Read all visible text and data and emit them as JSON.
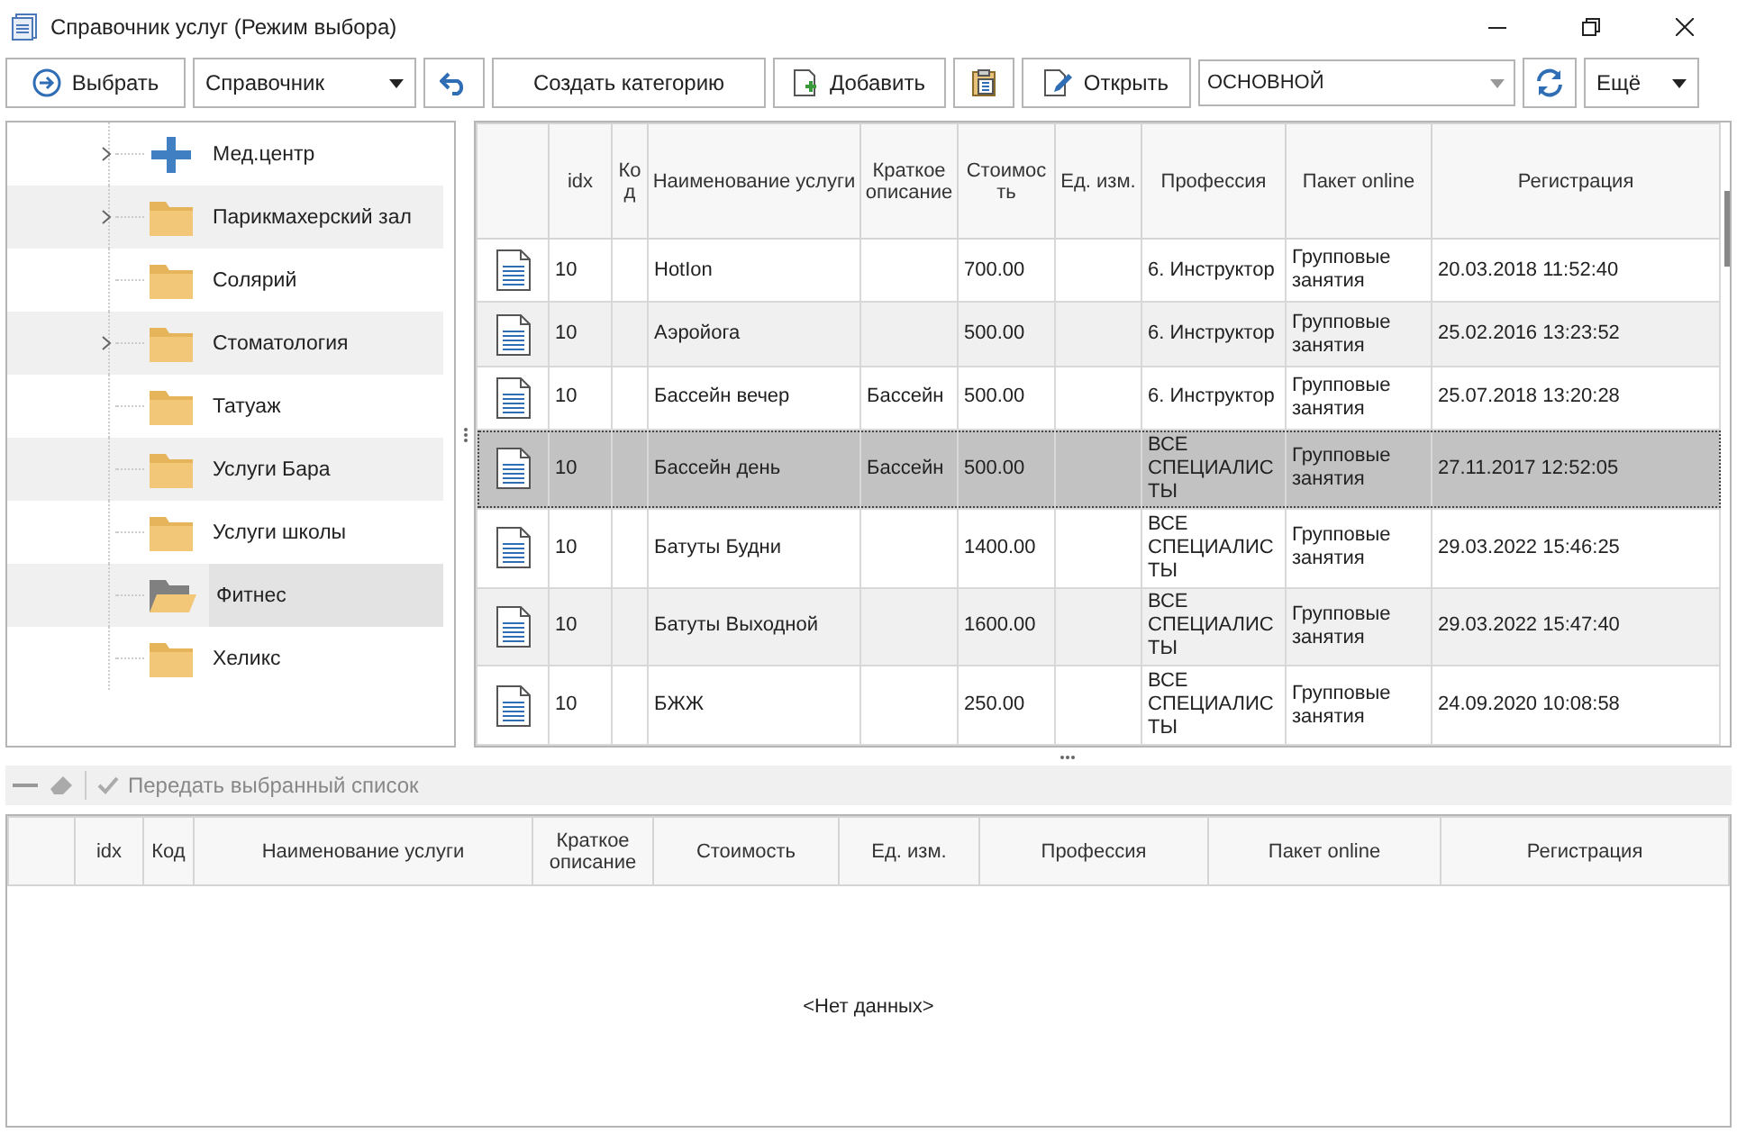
{
  "window": {
    "title": "Справочник услуг (Режим выбора)"
  },
  "toolbar": {
    "select_button": "Выбрать",
    "catalog_dropdown": "Справочник",
    "create_category_button": "Создать категорию",
    "add_button": "Добавить",
    "open_button": "Открыть",
    "profile_combo": "ОСНОВНОЙ",
    "more_dropdown": "Ещё"
  },
  "tree": {
    "items": [
      {
        "label": "Мед.центр",
        "kind": "plus",
        "expandable": true,
        "selected": false
      },
      {
        "label": "Парикмахерский зал",
        "kind": "folder",
        "expandable": true,
        "selected": false
      },
      {
        "label": "Солярий",
        "kind": "folder",
        "expandable": false,
        "selected": false
      },
      {
        "label": "Стоматология",
        "kind": "folder",
        "expandable": true,
        "selected": false
      },
      {
        "label": "Татуаж",
        "kind": "folder",
        "expandable": false,
        "selected": false
      },
      {
        "label": "Услуги Бара",
        "kind": "folder",
        "expandable": false,
        "selected": false
      },
      {
        "label": "Услуги школы",
        "kind": "folder",
        "expandable": false,
        "selected": false
      },
      {
        "label": "Фитнес",
        "kind": "opened",
        "expandable": false,
        "selected": true
      },
      {
        "label": "Хеликс",
        "kind": "folder",
        "expandable": false,
        "selected": false
      }
    ]
  },
  "grid": {
    "columns": [
      "idx",
      "Код",
      "Наименование услуги",
      "Краткое описание",
      "Стоимость",
      "Ед. изм.",
      "Профессия",
      "Пакет online",
      "Регистрация"
    ],
    "rows": [
      {
        "idx": "10",
        "name": "HotIon",
        "cost": "700.00",
        "profession": "6. Инструктор",
        "package": "Групповые занятия",
        "registered": "20.03.2018 11:52:40",
        "selected": false
      },
      {
        "idx": "10",
        "name": "Аэройога",
        "cost": "500.00",
        "profession": "6. Инструктор",
        "package": "Групповые занятия",
        "registered": "25.02.2016 13:23:52",
        "selected": false
      },
      {
        "idx": "10",
        "name": "Бассейн вечер",
        "short": "Бассейн",
        "cost": "500.00",
        "profession": "6. Инструктор",
        "package": "Групповые занятия",
        "registered": "25.07.2018 13:20:28",
        "selected": false
      },
      {
        "idx": "10",
        "name": "Бассейн день",
        "short": "Бассейн",
        "cost": "500.00",
        "profession": "ВСЕ СПЕЦИАЛИСТЫ",
        "package": "Групповые занятия",
        "registered": "27.11.2017 12:52:05",
        "selected": true
      },
      {
        "idx": "10",
        "name": "Батуты Будни",
        "cost": "1400.00",
        "profession": "ВСЕ СПЕЦИАЛИСТЫ",
        "package": "Групповые занятия",
        "registered": "29.03.2022 15:46:25",
        "selected": false
      },
      {
        "idx": "10",
        "name": "Батуты Выходной",
        "cost": "1600.00",
        "profession": "ВСЕ СПЕЦИАЛИСТЫ",
        "package": "Групповые занятия",
        "registered": "29.03.2022 15:47:40",
        "selected": false
      },
      {
        "idx": "10",
        "name": "БЖЖ",
        "cost": "250.00",
        "profession": "ВСЕ СПЕЦИАЛИСТЫ",
        "package": "Групповые занятия",
        "registered": "24.09.2020 10:08:58",
        "selected": false
      }
    ]
  },
  "selection_toolbar": {
    "transfer_button": {
      "label": "Передать выбранный список",
      "disabled": true
    }
  },
  "selected_grid": {
    "columns": [
      "idx",
      "Код",
      "Наименование услуги",
      "Краткое описание",
      "Стоимость",
      "Ед. изм.",
      "Профессия",
      "Пакет online",
      "Регистрация"
    ],
    "empty_text": "<Нет данных>"
  }
}
